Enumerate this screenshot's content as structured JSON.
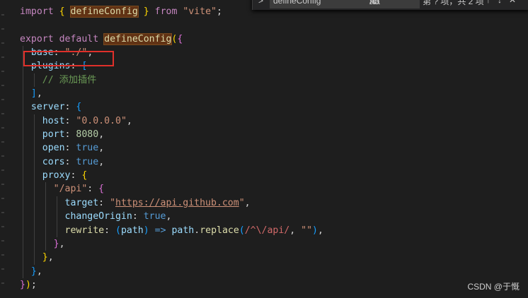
{
  "find": {
    "query": "defineConfig",
    "match_case": "Aa",
    "whole_word": "ab",
    "regex": ".*",
    "result": "第 ? 项，共 2 项"
  },
  "code_lines": [
    "import { defineConfig } from \"vite\";",
    "",
    "export default defineConfig({",
    "  base: \"./\",",
    "  plugins: [",
    "    // 添加插件",
    "  ],",
    "  server: {",
    "    host: \"0.0.0.0\",",
    "    port: 8080,",
    "    open: true,",
    "    cors: true,",
    "    proxy: {",
    "      \"/api\": {",
    "        target: \"https://api.github.com\",",
    "        changeOrigin: true,",
    "        rewrite: (path) => path.replace(/^\\/api/, \"\"),",
    "      },",
    "    },",
    "  },",
    "});"
  ],
  "watermark": "CSDN @于慨",
  "colors": {
    "background": "#1e1e1e",
    "keyword": "#c586c0",
    "string": "#ce9178",
    "property": "#9cdcfe",
    "highlight_box": "#e0302a"
  }
}
